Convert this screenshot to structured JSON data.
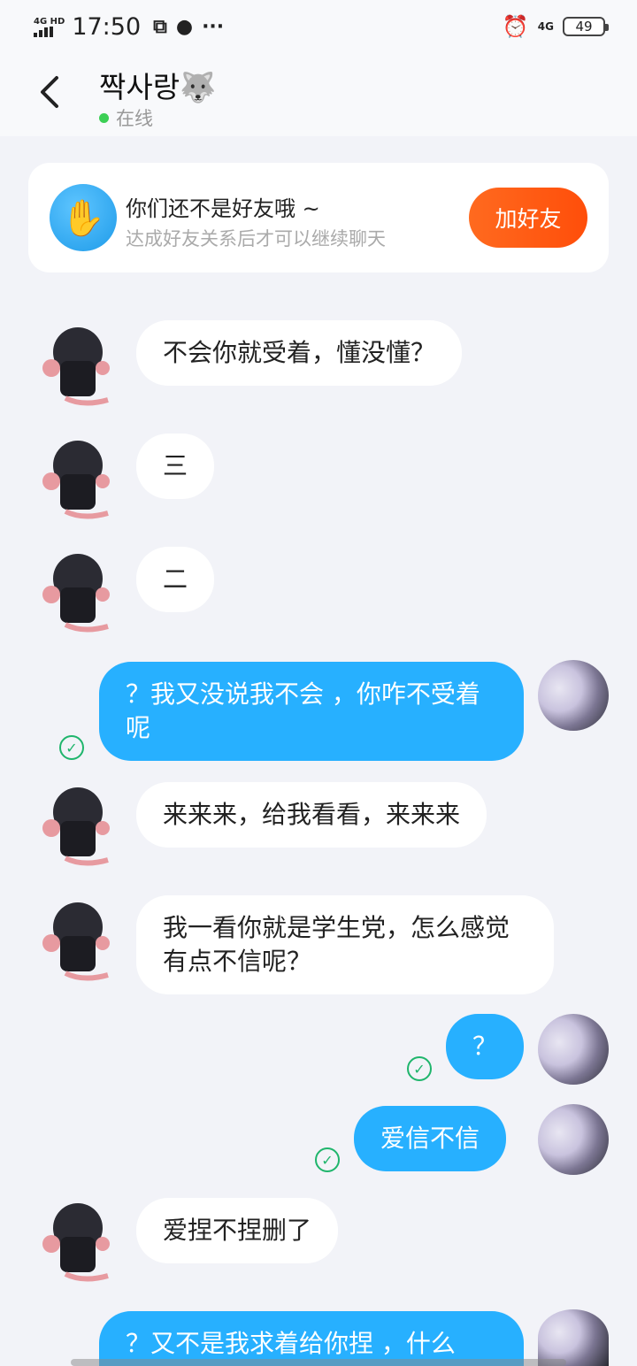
{
  "status_bar": {
    "network": "4G HD",
    "time": "17:50",
    "icons": [
      "sim-icon",
      "media-icon",
      "more-dots-icon"
    ],
    "right_network": "4G",
    "battery": "49"
  },
  "header": {
    "back_icon": "back-arrow-icon",
    "title": "짝사랑🐺",
    "status": "在线"
  },
  "friend_card": {
    "title": "你们还不是好友哦 ~",
    "subtitle": "达成好友关系后才可以继续聊天",
    "button": "加好友"
  },
  "messages": [
    {
      "from": "other",
      "text": "不会你就受着，懂没懂？"
    },
    {
      "from": "other",
      "text": "三"
    },
    {
      "from": "other",
      "text": "二"
    },
    {
      "from": "self",
      "text": "？我又没说我不会 ，你咋不受着呢",
      "read": true
    },
    {
      "from": "other",
      "text": "来来来，给我看看，来来来"
    },
    {
      "from": "other",
      "text": "我一看你就是学生党，怎么感觉有点不信呢？"
    },
    {
      "from": "self",
      "text": "？",
      "read": true
    },
    {
      "from": "self",
      "text": "爱信不信",
      "read": true
    },
    {
      "from": "other",
      "text": "爱捏不捏删了"
    },
    {
      "from": "self",
      "text": "？又不是我求着给你捏 ，什么",
      "read": false
    }
  ],
  "colors": {
    "accent": "#27b0ff",
    "button": "#ff5a14",
    "online": "#3ccf55",
    "read_check": "#1fb56c"
  }
}
